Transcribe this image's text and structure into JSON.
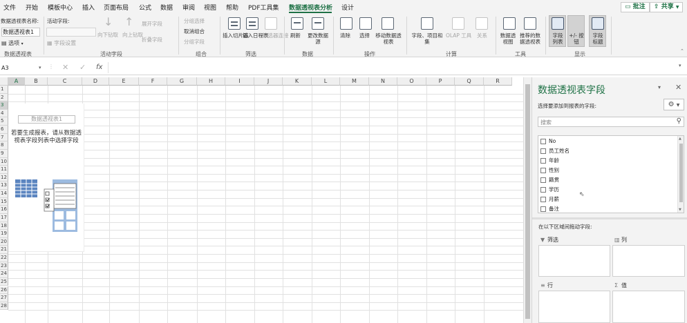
{
  "menu": {
    "items": [
      "文件",
      "开始",
      "模板中心",
      "插入",
      "页面布局",
      "公式",
      "数据",
      "审阅",
      "视图",
      "帮助",
      "PDF工具集",
      "数据透视表分析",
      "设计"
    ],
    "active": "数据透视表分析",
    "comment_label": "批注",
    "share_label": "共享"
  },
  "ribbon": {
    "pivot_name_label": "数据透视表名称:",
    "pivot_name_value": "数据透视表1",
    "options_label": "选项",
    "active_field_label": "活动字段:",
    "field_settings_label": "字段设置",
    "drill_down_label": "向下钻取",
    "drill_up_label": "向上钻取",
    "expand_field_label": "展开字段",
    "collapse_field_label": "折叠字段",
    "group_selection_label": "分组选择",
    "ungroup_label": "取消组合",
    "group_field_label": "分组字段",
    "insert_slicer_label": "插入切片器",
    "insert_timeline_label": "插入日程表",
    "filter_connections_label": "筛选器连接",
    "refresh_label": "刷新",
    "change_source_label": "更改数据源",
    "clear_label": "清除",
    "select_label": "选择",
    "move_pivot_label": "移动数据透视表",
    "fields_items_label": "字段、项目和集",
    "olap_tools_label": "OLAP 工具",
    "relationships_label": "关系",
    "pivot_chart_label": "数据透视图",
    "recommended_label": "推荐的数据透视表",
    "field_list_label": "字段列表",
    "buttons_label": "+/- 按钮",
    "field_headers_label": "字段标题",
    "groups": [
      "数据透视表",
      "活动字段",
      "组合",
      "筛选",
      "数据",
      "操作",
      "计算",
      "工具",
      "显示"
    ]
  },
  "formula_bar": {
    "name_box": "A3",
    "cancel_symbol": "✕",
    "enter_symbol": "✓",
    "fx_symbol": "fx",
    "formula": ""
  },
  "grid": {
    "columns": [
      "A",
      "B",
      "C",
      "D",
      "E",
      "F",
      "G",
      "H",
      "I",
      "J",
      "K",
      "L",
      "M",
      "N",
      "O",
      "P",
      "Q",
      "R"
    ],
    "rows": [
      "1",
      "2",
      "3",
      "4",
      "5",
      "6",
      "7",
      "8",
      "9",
      "10",
      "11",
      "12",
      "13",
      "14",
      "15",
      "16",
      "17",
      "18",
      "19",
      "20",
      "21",
      "22",
      "23",
      "24",
      "25",
      "26",
      "27",
      "28"
    ],
    "selected_column": "A",
    "selected_row": "3",
    "pivot_placeholder_title": "数据透视表1",
    "pivot_placeholder_hint": "若要生成报表，请从数据透视表字段列表中选择字段"
  },
  "task_pane": {
    "title": "数据透视表字段",
    "choose_fields_label": "选择要添加到报表的字段:",
    "search_placeholder": "搜索",
    "fields": [
      "No",
      "员工姓名",
      "年龄",
      "性别",
      "籍贯",
      "学历",
      "月薪",
      "备注"
    ],
    "drag_label": "在以下区域间拖动字段:",
    "filter_area": "筛选",
    "columns_area": "列",
    "rows_area": "行",
    "values_area": "值"
  },
  "colors": {
    "accent": "#1e7145",
    "ribbon_bg": "#f3f3f3"
  }
}
